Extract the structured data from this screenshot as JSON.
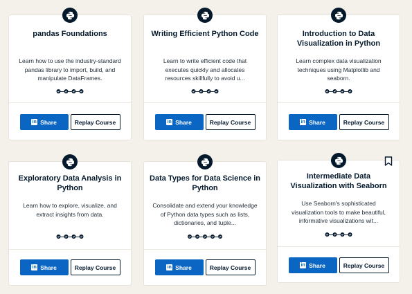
{
  "labels": {
    "share": "Share",
    "replay": "Replay Course"
  },
  "colors": {
    "background": "#f4f1ea",
    "navy": "#05192d",
    "linkedin": "#0a66c2"
  },
  "icons": {
    "course_badge": "python-icon",
    "bookmark": "bookmark-icon",
    "linkedin": "linkedin-icon",
    "progress_dot": "check-icon"
  },
  "courses": [
    {
      "title": "pandas Foundations",
      "description": "Learn how to use the industry-standard pandas library to import, build, and manipulate DataFrames.",
      "progress_steps": 4,
      "progress_completed": 4
    },
    {
      "title": "Writing Efficient Python Code",
      "description": "Learn to write efficient code that executes quickly and allocates resources skillfully to avoid u...",
      "progress_steps": 4,
      "progress_completed": 4
    },
    {
      "title": "Introduction to Data Visualization in Python",
      "description": "Learn complex data visualization techniques using Matplotlib and seaborn.",
      "progress_steps": 4,
      "progress_completed": 4
    },
    {
      "title": "Exploratory Data Analysis in Python",
      "description": "Learn how to explore, visualize, and extract insights from data.",
      "progress_steps": 4,
      "progress_completed": 4
    },
    {
      "title": "Data Types for Data Science in Python",
      "description": "Consolidate and extend your knowledge of Python data types such as lists, dictionaries, and tuple...",
      "progress_steps": 5,
      "progress_completed": 5
    },
    {
      "title": "Intermediate Data Visualization with Seaborn",
      "description": "Use Seaborn's sophisticated visualization tools to make beautiful, informative visualizations wit...",
      "progress_steps": 4,
      "progress_completed": 4
    }
  ]
}
